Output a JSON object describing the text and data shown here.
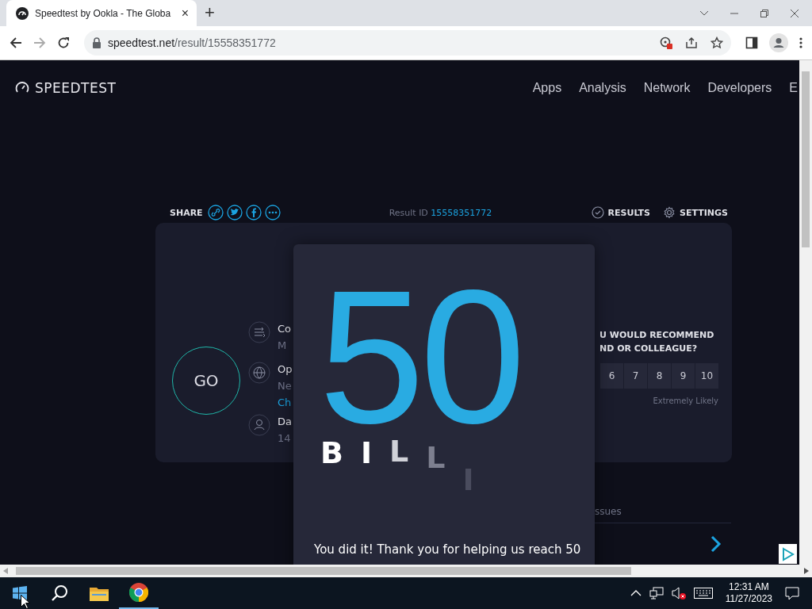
{
  "browser": {
    "tab": {
      "title": "Speedtest by Ookla - The Globa",
      "close": "×"
    },
    "new_tab": "+",
    "address": {
      "host": "speedtest.net",
      "path": "/result/15558351772"
    }
  },
  "header": {
    "logo": "SPEEDTEST",
    "nav": [
      "Apps",
      "Analysis",
      "Network",
      "Developers",
      "E"
    ]
  },
  "toolbar": {
    "share_label": "SHARE",
    "result_label": "Result ID",
    "result_id": "15558351772",
    "results": "RESULTS",
    "settings": "SETTINGS"
  },
  "card": {
    "go": "GO",
    "info": [
      {
        "title": "Co",
        "lines": [
          {
            "text": "M",
            "kind": "text"
          }
        ]
      },
      {
        "title": "Op",
        "lines": [
          {
            "text": "Ne",
            "kind": "text"
          },
          {
            "text": "Ch",
            "kind": "link"
          }
        ]
      },
      {
        "title": "Da",
        "lines": [
          {
            "text": "14",
            "kind": "text"
          }
        ]
      }
    ],
    "rating": {
      "question": [
        "U WOULD RECOMMEND",
        "ND OR COLLEAGUE?"
      ],
      "options": [
        "6",
        "7",
        "8",
        "9",
        "10"
      ],
      "high_label": "Extremely Likely"
    }
  },
  "below": {
    "issues": "ssues"
  },
  "modal": {
    "number": "50",
    "letters": [
      "B",
      "I",
      "L",
      "L",
      "I"
    ],
    "message": "You did it! Thank you for helping us reach 50"
  },
  "taskbar": {
    "time": "12:31 AM",
    "date": "11/27/2023"
  }
}
